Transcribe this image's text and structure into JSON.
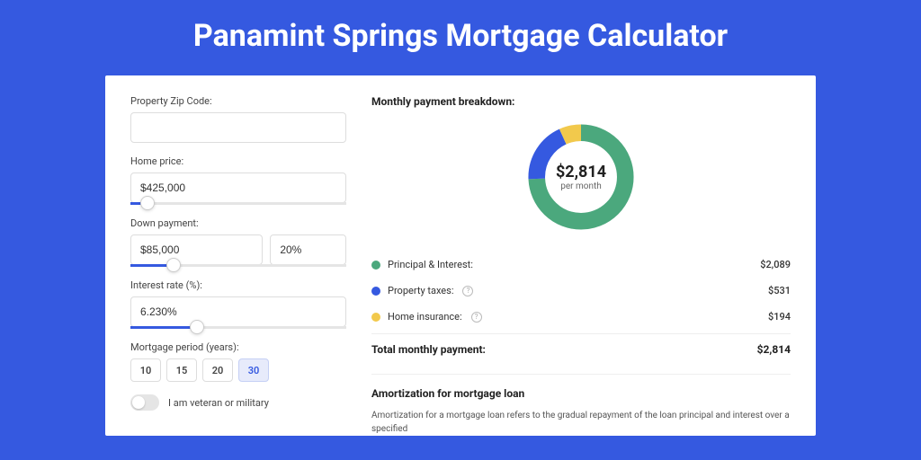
{
  "title": "Panamint Springs Mortgage Calculator",
  "form": {
    "zip_label": "Property Zip Code:",
    "zip_value": "",
    "price_label": "Home price:",
    "price_value": "$425,000",
    "price_slider_pct": 8,
    "down_label": "Down payment:",
    "down_value": "$85,000",
    "down_pct": "20%",
    "down_slider_pct": 20,
    "rate_label": "Interest rate (%):",
    "rate_value": "6.230%",
    "rate_slider_pct": 31,
    "period_label": "Mortgage period (years):",
    "periods": [
      "10",
      "15",
      "20",
      "30"
    ],
    "period_active": 3,
    "veteran_label": "I am veteran or military"
  },
  "breakdown": {
    "heading": "Monthly payment breakdown:",
    "center_value": "$2,814",
    "center_sub": "per month",
    "items": [
      {
        "label": "Principal & Interest:",
        "value": "$2,089",
        "color": "#4BA87D",
        "has_info": false,
        "arc_pct": 74.2
      },
      {
        "label": "Property taxes:",
        "value": "$531",
        "color": "#3559E0",
        "has_info": true,
        "arc_pct": 18.9
      },
      {
        "label": "Home insurance:",
        "value": "$194",
        "color": "#F2C94C",
        "has_info": true,
        "arc_pct": 6.9
      }
    ],
    "total_label": "Total monthly payment:",
    "total_value": "$2,814"
  },
  "amort": {
    "heading": "Amortization for mortgage loan",
    "text": "Amortization for a mortgage loan refers to the gradual repayment of the loan principal and interest over a specified"
  }
}
